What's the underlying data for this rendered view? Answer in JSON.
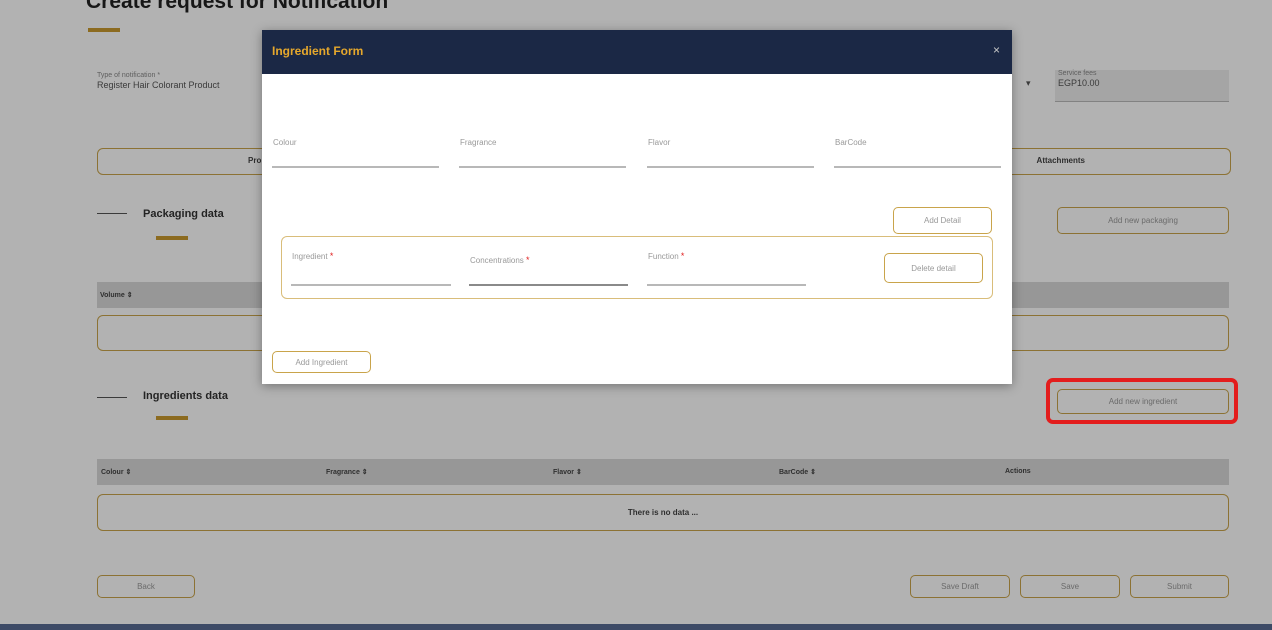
{
  "page": {
    "title": "Create request for Notification",
    "service_field": {
      "label": "Type of notification *",
      "value": "Register Hair Colorant Product"
    },
    "fee_field": {
      "label": "Service fees",
      "value": "EGP10.00"
    },
    "dropdown_caret": "▾",
    "tabs": {
      "left_label": "Pro",
      "right_label": "Attachments"
    },
    "packaging": {
      "title": "Packaging data",
      "add_button": "Add new packaging",
      "header": "Volume ⇕"
    },
    "ingredients": {
      "title": "Ingredients data",
      "add_button": "Add new ingredient",
      "columns": [
        "Colour ⇕",
        "Fragrance ⇕",
        "Flavor ⇕",
        "BarCode ⇕",
        "Actions"
      ],
      "empty_text": "There is no data ..."
    },
    "footer": {
      "back_button": "Back",
      "draft_button": "Save Draft",
      "save_button": "Save",
      "submit_button": "Submit"
    },
    "colors": {
      "accent": "#c99a2e",
      "modal_header": "#1b2845",
      "highlight": "#e31d1d"
    }
  },
  "modal": {
    "title": "Ingredient Form",
    "close_icon": "×",
    "fields": {
      "colour": "Colour",
      "fragrance": "Fragrance",
      "flavor": "Flavor",
      "barcode": "BarCode"
    },
    "add_detail_button": "Add Detail",
    "detail_fields": {
      "ingredient": "Ingredient",
      "concentrations": "Concentrations",
      "function": "Function"
    },
    "required_mark": "*",
    "delete_detail_button": "Delete detail",
    "add_ingredient_button": "Add Ingredient"
  }
}
